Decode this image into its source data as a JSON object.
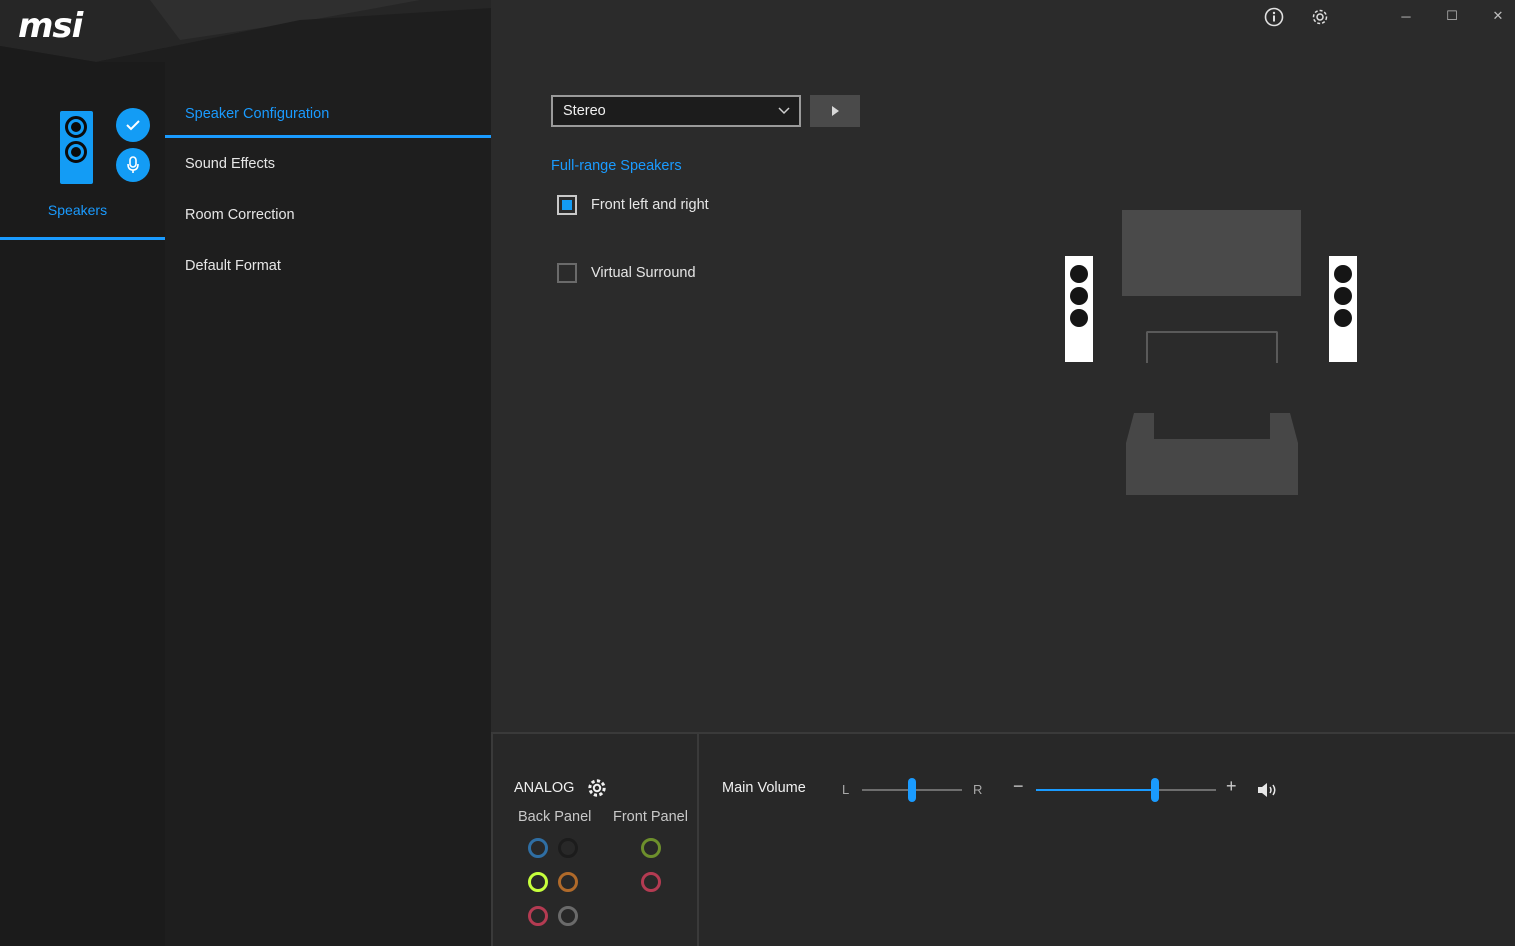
{
  "app": {
    "logo": "msi"
  },
  "titlebar": {
    "info_icon": "info-icon",
    "settings_icon": "gear-icon",
    "minimize": "─",
    "maximize": "☐",
    "close": "✕"
  },
  "device": {
    "label": "Speakers"
  },
  "nav": {
    "items": [
      {
        "label": "Speaker Configuration",
        "active": true
      },
      {
        "label": "Sound Effects",
        "active": false
      },
      {
        "label": "Room Correction",
        "active": false
      },
      {
        "label": "Default Format",
        "active": false
      }
    ]
  },
  "config": {
    "mode_value": "Stereo",
    "section_title": "Full-range Speakers",
    "options": [
      {
        "label": "Front left and right",
        "checked": true
      },
      {
        "label": "Virtual Surround",
        "checked": false
      }
    ]
  },
  "bottom": {
    "analog_title": "ANALOG",
    "back_panel": "Back Panel",
    "front_panel": "Front Panel",
    "jack_colors": {
      "back": [
        "#2f6ea3",
        "#1c1c1c",
        "#c6ff3c",
        "#b06a2a",
        "#b43b52",
        "#6a6a6a"
      ],
      "front": [
        "#6d8f2c",
        "#b43b52"
      ]
    },
    "volume_label": "Main Volume",
    "balance_left": "L",
    "balance_right": "R",
    "balance_level": 0.5,
    "volume_level": 0.66,
    "minus": "−",
    "plus": "+"
  },
  "colors": {
    "accent": "#1a9bff"
  }
}
